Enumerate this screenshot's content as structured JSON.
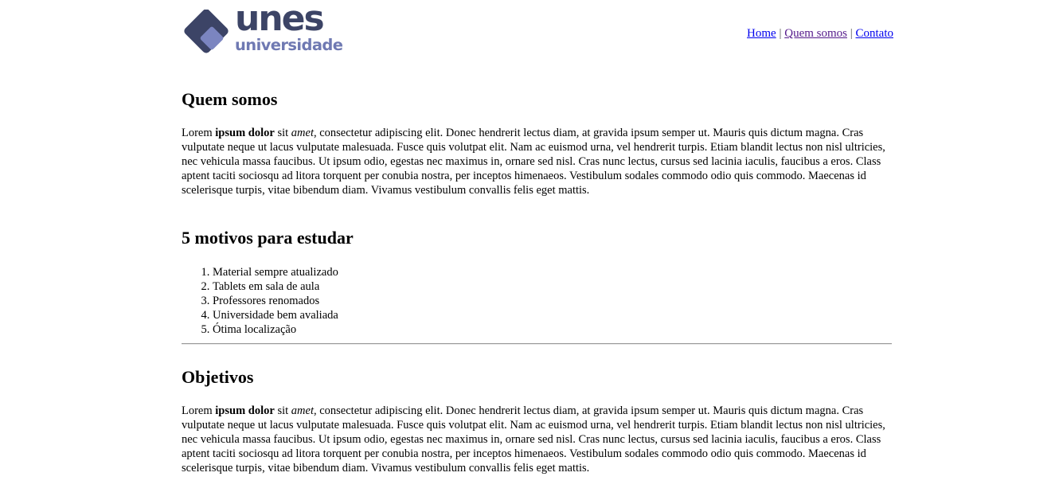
{
  "logo": {
    "word": "unes",
    "sub": "universidade"
  },
  "nav": {
    "home": "Home",
    "sep1": "|",
    "quem": "Quem somos",
    "sep2": "|",
    "contato": "Contato"
  },
  "quem": {
    "title": "Quem somos",
    "p_pre": "Lorem ",
    "p_bold": "ipsum dolor",
    "p_mid": " sit ",
    "p_em": "amet",
    "p_rest": ", consectetur adipiscing elit. Donec hendrerit lectus diam, at gravida ipsum semper ut. Mauris quis dictum magna. Cras vulputate neque ut lacus vulputate malesuada. Fusce quis volutpat elit. Nam ac euismod urna, vel hendrerit turpis. Etiam blandit lectus non nisl ultricies, nec vehicula massa faucibus. Ut ipsum odio, egestas nec maximus in, ornare sed nisl. Cras nunc lectus, cursus sed lacinia iaculis, faucibus a eros. Class aptent taciti sociosqu ad litora torquent per conubia nostra, per inceptos himenaeos. Vestibulum sodales commodo odio quis commodo. Maecenas id scelerisque turpis, vitae bibendum diam. Vivamus vestibulum convallis felis eget mattis."
  },
  "motivos": {
    "title": "5 motivos para estudar",
    "items": [
      "Material sempre atualizado",
      "Tablets em sala de aula",
      "Professores renomados",
      "Universidade bem avaliada",
      "Ótima localização"
    ]
  },
  "objetivos": {
    "title": "Objetivos",
    "p_pre": "Lorem ",
    "p_bold": "ipsum dolor",
    "p_mid": " sit ",
    "p_em": "amet",
    "p_rest": ", consectetur adipiscing elit. Donec hendrerit lectus diam, at gravida ipsum semper ut. Mauris quis dictum magna. Cras vulputate neque ut lacus vulputate malesuada. Fusce quis volutpat elit. Nam ac euismod urna, vel hendrerit turpis. Etiam blandit lectus non nisl ultricies, nec vehicula massa faucibus. Ut ipsum odio, egestas nec maximus in, ornare sed nisl. Cras nunc lectus, cursus sed lacinia iaculis, faucibus a eros. Class aptent taciti sociosqu ad litora torquent per conubia nostra, per inceptos himenaeos. Vestibulum sodales commodo odio quis commodo. Maecenas id scelerisque turpis, vitae bibendum diam. Vivamus vestibulum convallis felis eget mattis."
  },
  "colors": {
    "logo_dark": "#3c4466",
    "logo_light": "#6f79b2",
    "link": "#0000ee",
    "link_visited": "#551a8b"
  }
}
